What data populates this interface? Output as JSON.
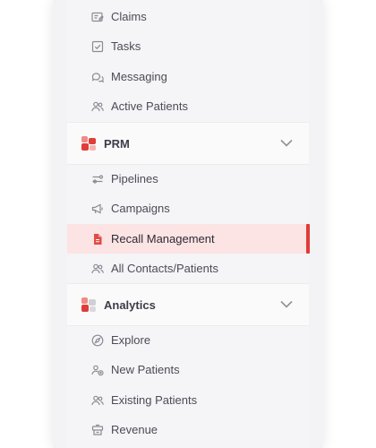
{
  "nav": {
    "top_items": [
      {
        "label": "Claims",
        "icon": "claims-icon"
      },
      {
        "label": "Tasks",
        "icon": "tasks-checkbox-icon"
      },
      {
        "label": "Messaging",
        "icon": "chat-bubbles-icon"
      },
      {
        "label": "Active Patients",
        "icon": "users-icon"
      }
    ],
    "prm": {
      "title": "PRM",
      "items": [
        {
          "label": "Pipelines",
          "icon": "pipelines-icon"
        },
        {
          "label": "Campaigns",
          "icon": "megaphone-icon"
        },
        {
          "label": "Recall Management",
          "icon": "document-icon",
          "active": true
        },
        {
          "label": "All Contacts/Patients",
          "icon": "users-icon"
        }
      ]
    },
    "analytics": {
      "title": "Analytics",
      "items": [
        {
          "label": "Explore",
          "icon": "compass-icon"
        },
        {
          "label": "New Patients",
          "icon": "user-add-icon"
        },
        {
          "label": "Existing Patients",
          "icon": "users-icon"
        },
        {
          "label": "Revenue",
          "icon": "revenue-icon"
        }
      ]
    }
  },
  "colors": {
    "accent": "#e03c38",
    "active_bg": "#fde4e4"
  }
}
